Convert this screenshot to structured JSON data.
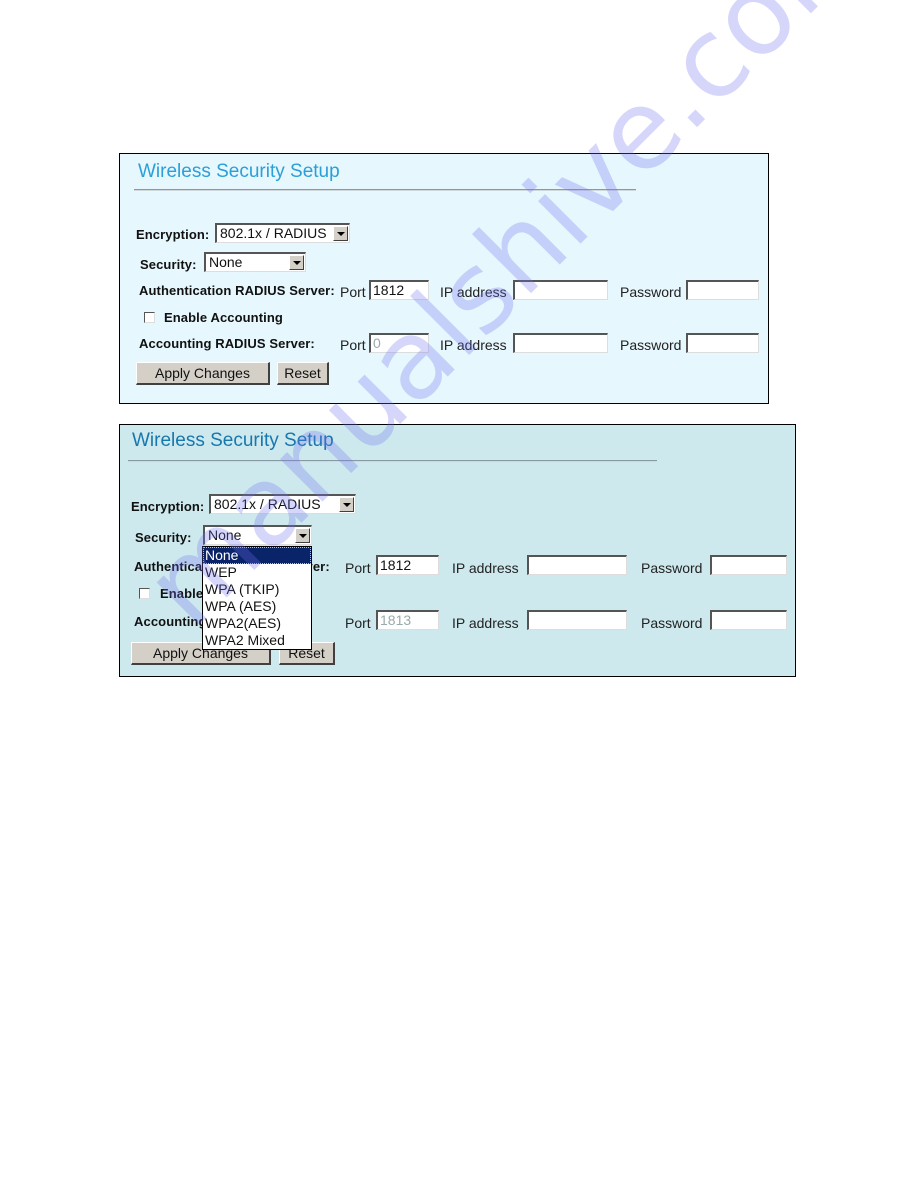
{
  "panels": [
    {
      "title": "Wireless Security Setup",
      "encryption": {
        "label": "Encryption:",
        "value": "802.1x / RADIUS"
      },
      "security": {
        "label": "Security:",
        "value": "None"
      },
      "auth_server": {
        "label": "Authentication RADIUS Server:",
        "port_label": "Port",
        "port_value": "1812",
        "ip_label": "IP address",
        "ip_value": "",
        "password_label": "Password",
        "password_value": ""
      },
      "enable_accounting": {
        "label": "Enable Accounting",
        "checked": false
      },
      "acct_server": {
        "label": "Accounting RADIUS Server:",
        "port_label": "Port",
        "port_value": "0",
        "ip_label": "IP address",
        "ip_value": "",
        "password_label": "Password",
        "password_value": ""
      },
      "buttons": {
        "apply": "Apply Changes",
        "reset": "Reset"
      }
    },
    {
      "title": "Wireless Security Setup",
      "encryption": {
        "label": "Encryption:",
        "value": "802.1x / RADIUS"
      },
      "security": {
        "label": "Security:",
        "value": "None",
        "options": [
          "None",
          "WEP",
          "WPA (TKIP)",
          "WPA (AES)",
          "WPA2(AES)",
          "WPA2 Mixed"
        ],
        "highlighted": "None"
      },
      "auth_server": {
        "label": "Authentication RADIUS Server:",
        "port_label": "Port",
        "port_value": "1812",
        "ip_label": "IP address",
        "ip_value": "",
        "password_label": "Password",
        "password_value": ""
      },
      "enable_accounting": {
        "label": "Enable Accounting",
        "checked": false
      },
      "acct_server": {
        "label": "Accounting RADIUS Server:",
        "port_label": "Port",
        "port_value": "1813",
        "ip_label": "IP address",
        "ip_value": "",
        "password_label": "Password",
        "password_value": ""
      },
      "buttons": {
        "apply": "Apply Changes",
        "reset": "Reset"
      }
    }
  ],
  "watermark": "manualshive.com",
  "colors": {
    "panel1_bg": "#e6f7fd",
    "panel2_bg": "#cde9ee",
    "panel1_title": "#2b9fd8",
    "panel2_title": "#1877ad",
    "dropdown_highlight": "#0a246a"
  }
}
